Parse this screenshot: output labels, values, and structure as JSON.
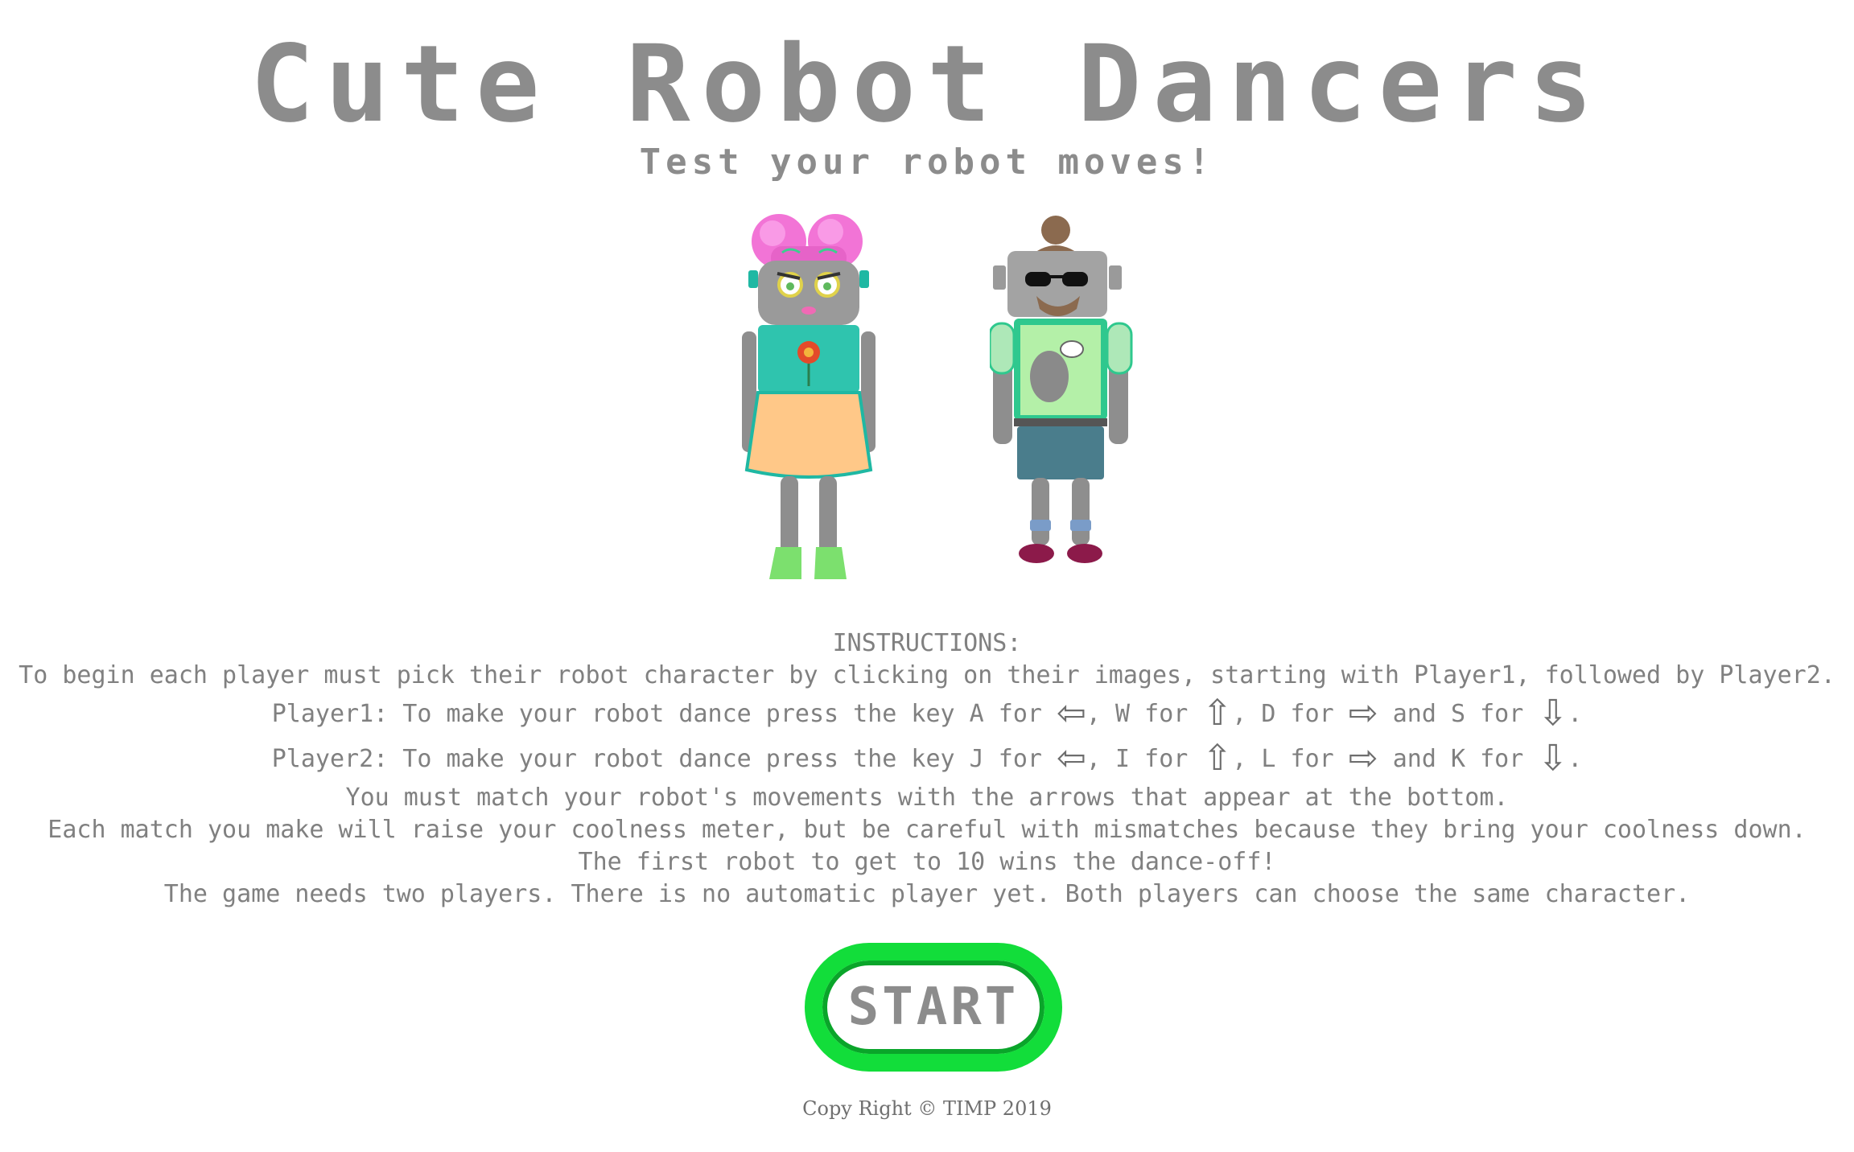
{
  "header": {
    "title": "Cute Robot Dancers",
    "subtitle": "Test your robot moves!"
  },
  "characters": [
    {
      "name": "robot-girl"
    },
    {
      "name": "robot-boy"
    }
  ],
  "instructions": {
    "heading": "INSTRUCTIONS:",
    "line1": "To begin each player must pick their robot character by clicking on their images, starting with Player1, followed by Player2.",
    "player1": {
      "prefix": "Player1: To make your robot dance press the key A for ",
      "up_text": ", W for ",
      "right_text": ", D for ",
      "down_text": " and S for ",
      "end": "."
    },
    "player2": {
      "prefix": "Player2: To make your robot dance press the key J for ",
      "up_text": ", I for ",
      "right_text": ", L for ",
      "down_text": " and K for ",
      "end": "."
    },
    "arrows": {
      "left": "⇦",
      "up": "⇧",
      "right": "⇨",
      "down": "⇩"
    },
    "line_match": "You must match your robot's movements with the arrows that appear at the bottom.",
    "line_meter": "Each match you make will raise your coolness meter, but be careful with mismatches because they bring your coolness down.",
    "line_win": "The first robot to get to 10 wins the dance-off!",
    "line_players": "The game needs two players. There is no automatic player yet. Both players can choose the same character."
  },
  "start_button": {
    "label": "START",
    "ring_color": "#12dd3a",
    "inner_ring_color": "#0aa52a"
  },
  "footer": {
    "copyright": "Copy Right © TIMP 2019"
  }
}
